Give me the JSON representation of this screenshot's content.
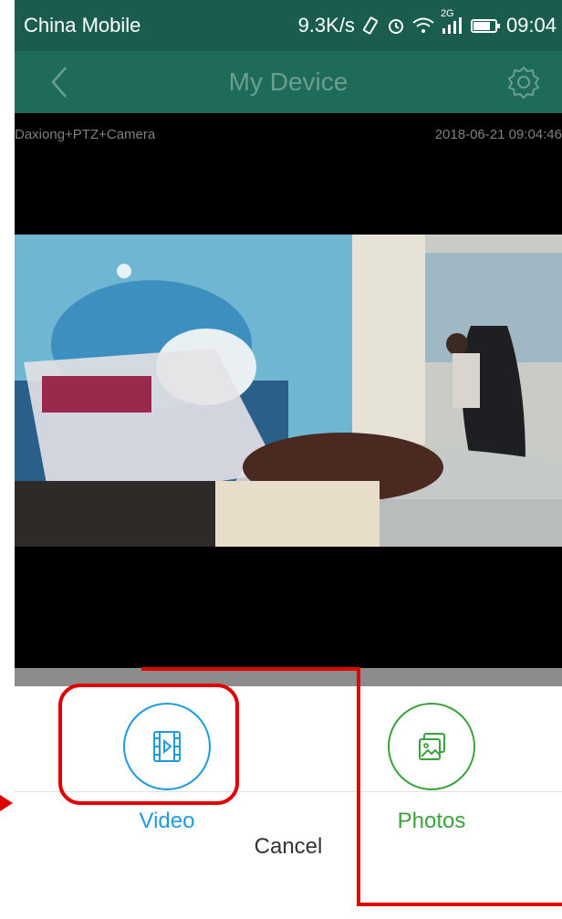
{
  "status_bar": {
    "carrier": "China Mobile",
    "speed": "9.3K/s",
    "network": "2G",
    "time": "09:04"
  },
  "header": {
    "title": "My Device",
    "back_icon": "chevron-left-icon",
    "settings_icon": "gear-icon"
  },
  "video": {
    "camera_name": "Daxiong+PTZ+Camera",
    "timestamp": "2018-06-21 09:04:46"
  },
  "share_sheet": {
    "options": [
      {
        "label": "Video",
        "icon": "video-file-icon",
        "color": "#1e9be0"
      },
      {
        "label": "Photos",
        "icon": "photos-icon",
        "color": "#3aa23a"
      }
    ],
    "cancel_label": "Cancel"
  },
  "colors": {
    "status_bar": "#1a5d4e",
    "header": "#1f6b5a",
    "annotation": "#e00000"
  }
}
